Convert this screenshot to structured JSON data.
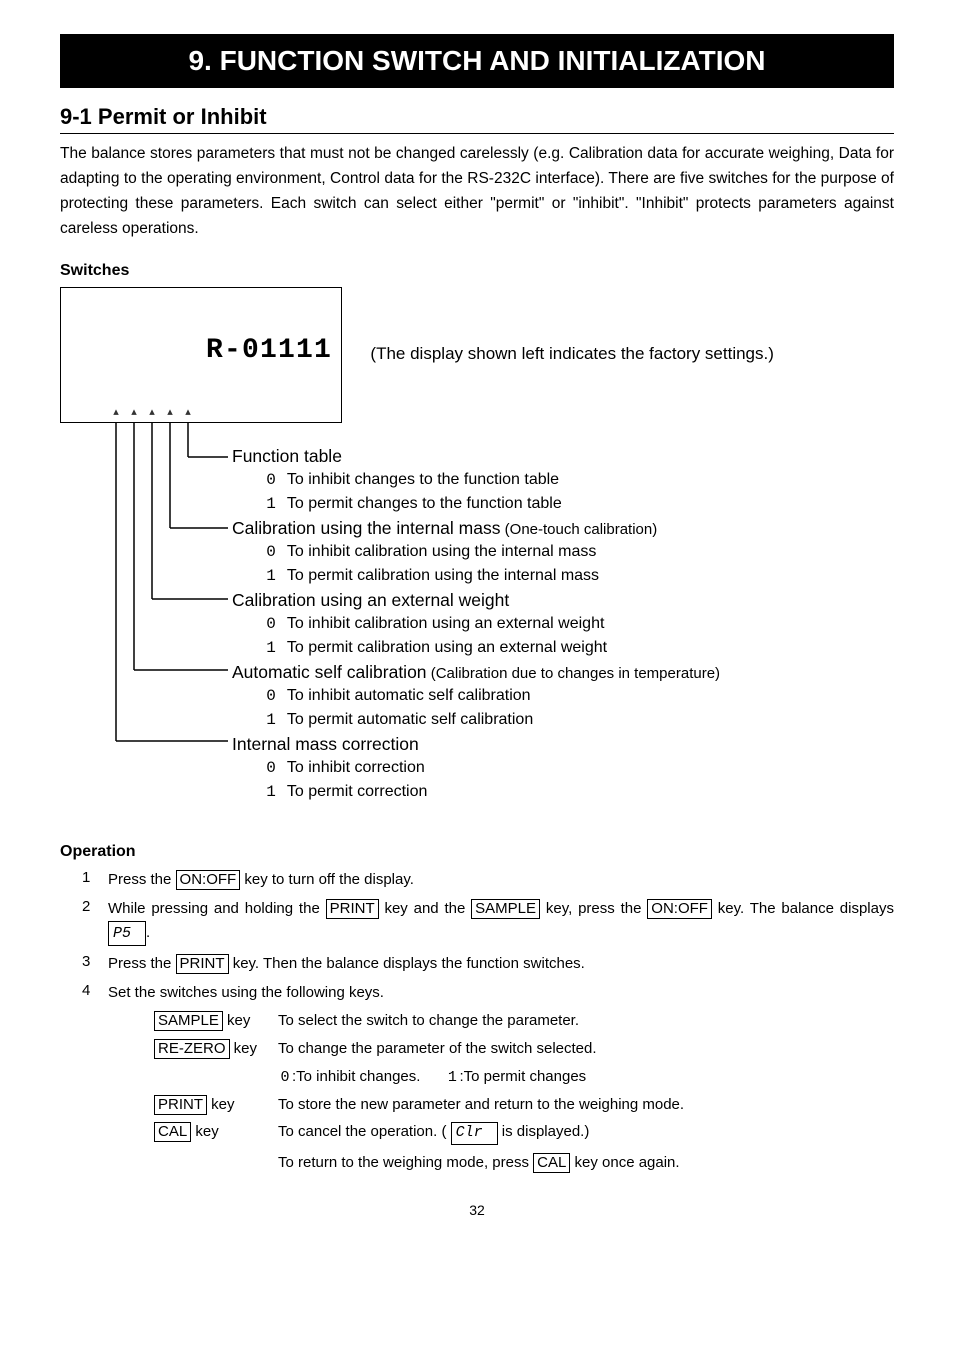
{
  "chapter_title": "9.  FUNCTION SWITCH AND INITIALIZATION",
  "section_title": "9-1  Permit or Inhibit",
  "intro_paragraph": "The balance stores parameters that must not be changed carelessly (e.g. Calibration data for accurate weighing, Data for adapting to the operating environment, Control data for the RS-232C interface). There are five switches for the purpose of protecting these parameters. Each switch can select either \"permit\" or \"inhibit\". \"Inhibit\" protects parameters against careless operations.",
  "switches_heading": "Switches",
  "display_text": "R - 0 1 1 1 1",
  "factory_note": "(The display shown left indicates the factory settings.)",
  "tree": [
    {
      "head": "Function table",
      "paren": "",
      "opts": [
        {
          "sym": "0",
          "text": "To inhibit changes to the function table"
        },
        {
          "sym": "1",
          "text": "To permit changes to the function table"
        }
      ]
    },
    {
      "head": "Calibration using the internal mass",
      "paren": " (One-touch calibration)",
      "opts": [
        {
          "sym": "0",
          "text": "To inhibit calibration using the internal mass"
        },
        {
          "sym": "1",
          "text": "To permit calibration using the internal mass"
        }
      ]
    },
    {
      "head": "Calibration using an external weight",
      "paren": "",
      "opts": [
        {
          "sym": "0",
          "text": "To inhibit calibration using an external weight"
        },
        {
          "sym": "1",
          "text": "To permit calibration using an external weight"
        }
      ]
    },
    {
      "head": "Automatic self calibration",
      "paren": " (Calibration due to changes in temperature)",
      "opts": [
        {
          "sym": "0",
          "text": "To inhibit automatic self calibration"
        },
        {
          "sym": "1",
          "text": "To permit automatic self calibration"
        }
      ]
    },
    {
      "head": "Internal mass correction",
      "paren": "",
      "opts": [
        {
          "sym": "0",
          "text": "To inhibit correction"
        },
        {
          "sym": "1",
          "text": "To permit correction"
        }
      ]
    }
  ],
  "operation_heading": "Operation",
  "operation": {
    "step1": {
      "num": "1",
      "pre": "Press the ",
      "k_onoff": "ON:OFF",
      "post": " key to turn off the display."
    },
    "step2": {
      "num": "2",
      "t1": "While pressing and holding the ",
      "k_print": "PRINT",
      "t2": " key and the ",
      "k_sample": "SAMPLE",
      "t3": " key, press the ",
      "k_onoff": "ON:OFF",
      "t4": " key. The balance displays  ",
      "seg": "P5",
      "t5": "."
    },
    "step3": {
      "num": "3",
      "t1": "Press the ",
      "k_print": "PRINT",
      "t2": " key. Then the balance displays the function switches."
    },
    "step4": {
      "num": "4",
      "t": "Set the switches using the following keys."
    }
  },
  "keytable": {
    "sample": {
      "k": "SAMPLE",
      "suffix": " key",
      "desc": "To select the switch to change the parameter."
    },
    "rezero": {
      "k": "RE-ZERO",
      "suffix": " key",
      "desc": "To change the parameter of the switch selected.",
      "sub_sym0": "0",
      "sub_t0": ":To inhibit changes.",
      "sub_sym1": "1",
      "sub_t1": ":To permit changes"
    },
    "print": {
      "k": "PRINT",
      "suffix": " key",
      "desc": "To store the new parameter and return to the weighing mode."
    },
    "cal": {
      "k": "CAL",
      "suffix": " key",
      "d1": "To cancel the operation. (  ",
      "seg": "Clr",
      "d2": "  is displayed.)",
      "sub_t1": "To return to the weighing mode, press ",
      "sub_k": "CAL",
      "sub_t2": " key once again."
    }
  },
  "page_number": "32"
}
